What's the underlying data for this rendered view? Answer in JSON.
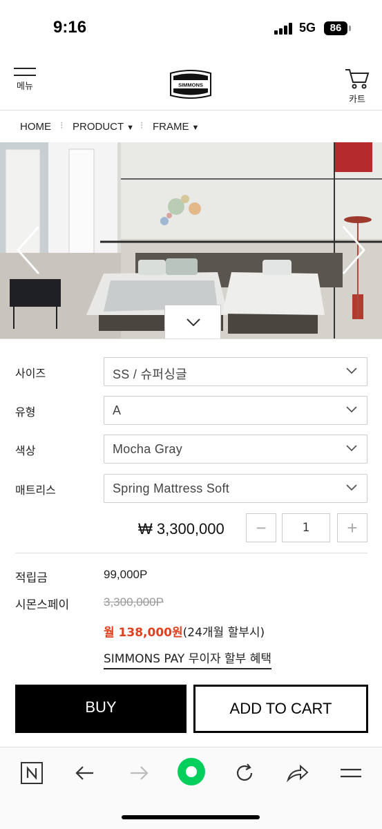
{
  "status_bar": {
    "time": "9:16",
    "network": "5G",
    "battery": "86"
  },
  "header": {
    "menu_label": "메뉴",
    "logo_text": "SIMMONS",
    "cart_label": "카트"
  },
  "breadcrumb": {
    "home": "HOME",
    "product": "PRODUCT",
    "frame": "FRAME"
  },
  "options": [
    {
      "label": "사이즈",
      "value": "SS / 슈퍼싱글"
    },
    {
      "label": "유형",
      "value": "A"
    },
    {
      "label": "색상",
      "value": "Mocha Gray"
    },
    {
      "label": "매트리스",
      "value": "Spring Mattress Soft"
    }
  ],
  "price": "₩ 3,300,000",
  "quantity": {
    "value": "1",
    "minus": "−",
    "plus": "+"
  },
  "points": {
    "label": "적립금",
    "value": "99,000P"
  },
  "simmons_pay": {
    "label": "시몬스페이",
    "original_price": "3,300,000P",
    "monthly_amount": "월 138,000원",
    "monthly_note": "(24개월 할부시)",
    "link_text": "SIMMONS PAY 무이자 할부 혜택"
  },
  "buttons": {
    "buy": "BUY",
    "add_to_cart": "ADD TO CART"
  },
  "browser_toolbar": {
    "icons": [
      "naver-icon",
      "back-arrow-icon",
      "forward-arrow-icon",
      "green-dot-icon",
      "reload-icon",
      "share-icon",
      "menu-lines-icon"
    ]
  },
  "colors": {
    "accent_red": "#e0401d",
    "buy_bg": "#000000",
    "green_dot": "#03cf5d"
  }
}
